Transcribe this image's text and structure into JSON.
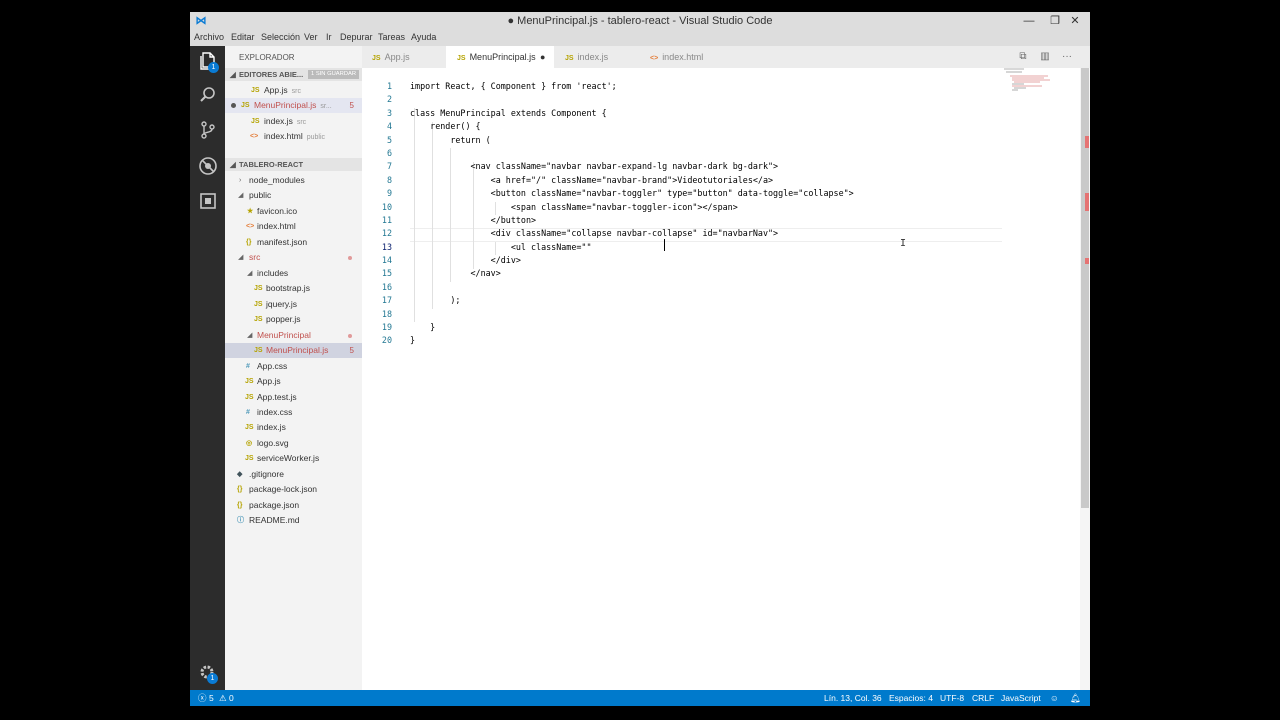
{
  "window": {
    "title": "● MenuPrincipal.js - tablero-react - Visual Studio Code"
  },
  "menu": [
    "Archivo",
    "Editar",
    "Selección",
    "Ver",
    "Ir",
    "Depurar",
    "Tareas",
    "Ayuda"
  ],
  "activity": {
    "explorer_badge": "1",
    "settings_badge": "1"
  },
  "sidebar": {
    "title": "EXPLORADOR",
    "open_editors": {
      "label": "EDITORES ABIE...",
      "badge": "1 SIN GUARDAR"
    },
    "open_files": [
      {
        "name": "App.js",
        "hint": "src",
        "icon": "JS"
      },
      {
        "name": "MenuPrincipal.js",
        "hint": "sr...",
        "icon": "JS",
        "count": "5"
      },
      {
        "name": "index.js",
        "hint": "src",
        "icon": "JS"
      },
      {
        "name": "index.html",
        "hint": "public",
        "icon": "<>"
      }
    ],
    "project": "TABLERO-REACT",
    "tree": {
      "node_modules": "node_modules",
      "public": "public",
      "favicon": "favicon.ico",
      "index_html": "index.html",
      "manifest": "manifest.json",
      "src": "src",
      "includes": "includes",
      "bootstrap": "bootstrap.js",
      "jquery": "jquery.js",
      "popper": "popper.js",
      "menu_dir": "MenuPrincipal",
      "menu_file": "MenuPrincipal.js",
      "menu_file_count": "5",
      "app_css": "App.css",
      "app_js": "App.js",
      "app_test": "App.test.js",
      "index_css": "index.css",
      "index_js": "index.js",
      "logo": "logo.svg",
      "sw": "serviceWorker.js",
      "gitignore": ".gitignore",
      "package_lock": "package-lock.json",
      "package": "package.json",
      "readme": "README.md"
    }
  },
  "tabs": [
    {
      "label": "App.js",
      "icon": "JS"
    },
    {
      "label": "MenuPrincipal.js",
      "icon": "JS",
      "dirty": "●"
    },
    {
      "label": "index.js",
      "icon": "JS"
    },
    {
      "label": "index.html",
      "icon": "<>"
    }
  ],
  "editor": {
    "line_numbers": [
      "1",
      "2",
      "3",
      "4",
      "5",
      "6",
      "7",
      "8",
      "9",
      "10",
      "11",
      "12",
      "13",
      "14",
      "15",
      "16",
      "17",
      "18",
      "19",
      "20"
    ],
    "lines": [
      "import React, { Component } from 'react';",
      "",
      "class MenuPrincipal extends Component {",
      "    render() {",
      "        return (",
      "",
      "            <nav className=\"navbar navbar-expand-lg navbar-dark bg-dark\">",
      "                <a href=\"/\" className=\"navbar-brand\">Videotutoriales</a>",
      "                <button className=\"navbar-toggler\" type=\"button\" data-toggle=\"collapse\">",
      "                    <span className=\"navbar-toggler-icon\"></span>",
      "                </button>",
      "                <div className=\"collapse navbar-collapse\" id=\"navbarNav\">",
      "                    <ul className=\"\"",
      "                </div>",
      "            </nav>",
      "",
      "        );",
      "",
      "    }",
      "}"
    ]
  },
  "status": {
    "errors": "5",
    "warnings": "0",
    "position": "Lín. 13, Col. 36",
    "spaces": "Espacios: 4",
    "encoding": "UTF-8",
    "eol": "CRLF",
    "language": "JavaScript"
  }
}
